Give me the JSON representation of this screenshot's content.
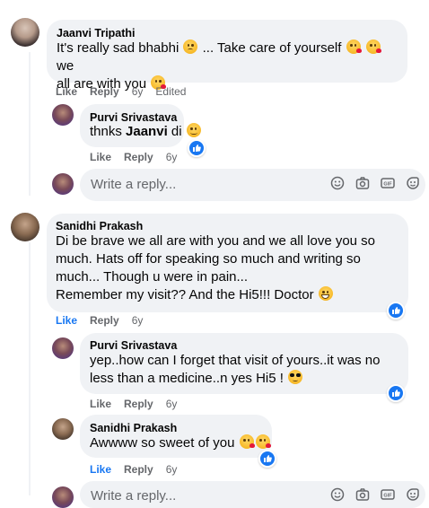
{
  "comments": [
    {
      "author": "Jaanvi Tripathi",
      "lines": [
        "It's really sad bhabhi",
        "... Take care of yourself",
        "we",
        "all are with you"
      ],
      "actions": {
        "like": "Like",
        "reply": "Reply",
        "time": "6y",
        "edited": "Edited"
      }
    },
    {
      "author": "Purvi Srivastava",
      "lines": [
        "thnks ",
        "Jaanvi",
        " di"
      ],
      "actions": {
        "like": "Like",
        "reply": "Reply",
        "time": "6y"
      }
    },
    {
      "author": "Sanidhi Prakash",
      "lines": [
        "Di be brave we all are with you and we all love you so",
        "much. Hats off for speaking so much and writing so",
        "much... Though u were in pain...",
        "Remember my visit?? And the Hi5!!! Doctor"
      ],
      "actions": {
        "like": "Like",
        "reply": "Reply",
        "time": "6y"
      }
    },
    {
      "author": "Purvi Srivastava",
      "lines": [
        "yep..how can I forget that visit of yours..it was no",
        "less than a medicine..n yes Hi5 !"
      ],
      "actions": {
        "like": "Like",
        "reply": "Reply",
        "time": "6y"
      }
    },
    {
      "author": "Sanidhi Prakash",
      "lines": [
        "Awwww so sweet of you"
      ],
      "actions": {
        "like": "Like",
        "reply": "Reply",
        "time": "6y"
      }
    }
  ],
  "reply_box": {
    "placeholder": "Write a reply..."
  },
  "colors": {
    "bubble": "#f0f2f5",
    "link_blue": "#1877f2",
    "meta_gray": "#65676b"
  }
}
